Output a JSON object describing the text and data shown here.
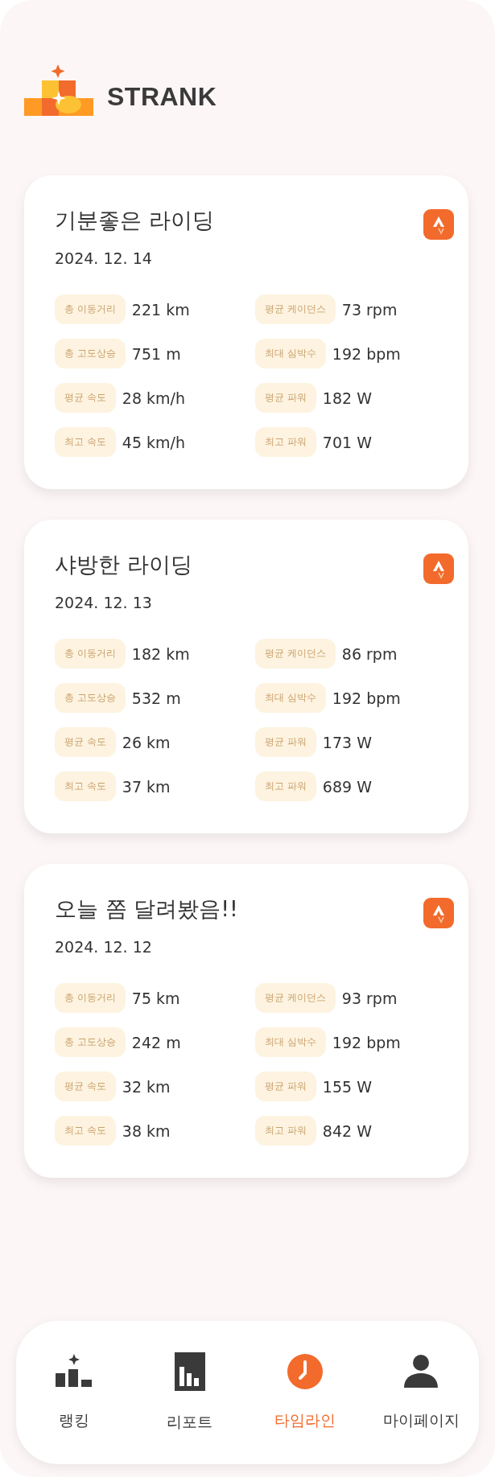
{
  "brand": {
    "name": "STRANK"
  },
  "rides": [
    {
      "title": "기분좋은 라이딩",
      "date": "2024. 12. 14",
      "stats": [
        {
          "label": "총 이동거리",
          "value": "221 km"
        },
        {
          "label": "평균 케이던스",
          "value": "73 rpm"
        },
        {
          "label": "총 고도상승",
          "value": "751 m"
        },
        {
          "label": "최대 심박수",
          "value": "192 bpm"
        },
        {
          "label": "평균 속도",
          "value": "28 km/h"
        },
        {
          "label": "평균 파워",
          "value": "182 W"
        },
        {
          "label": "최고 속도",
          "value": "45 km/h"
        },
        {
          "label": "최고 파워",
          "value": "701 W"
        }
      ]
    },
    {
      "title": "샤방한 라이딩",
      "date": "2024. 12. 13",
      "stats": [
        {
          "label": "총 이동거리",
          "value": "182 km"
        },
        {
          "label": "평균 케이던스",
          "value": "86 rpm"
        },
        {
          "label": "총 고도상승",
          "value": "532 m"
        },
        {
          "label": "최대 심박수",
          "value": "192 bpm"
        },
        {
          "label": "평균 속도",
          "value": "26 km"
        },
        {
          "label": "평균 파워",
          "value": "173 W"
        },
        {
          "label": "최고 속도",
          "value": "37 km"
        },
        {
          "label": "최고 파워",
          "value": "689 W"
        }
      ]
    },
    {
      "title": "오늘 쫌 달려봤음!!",
      "date": "2024. 12. 12",
      "stats": [
        {
          "label": "총 이동거리",
          "value": "75 km"
        },
        {
          "label": "평균 케이던스",
          "value": "93 rpm"
        },
        {
          "label": "총 고도상승",
          "value": "242 m"
        },
        {
          "label": "최대 심박수",
          "value": "192 bpm"
        },
        {
          "label": "평균 속도",
          "value": "32 km"
        },
        {
          "label": "평균 파워",
          "value": "155 W"
        },
        {
          "label": "최고 속도",
          "value": "38 km"
        },
        {
          "label": "최고 파워",
          "value": "842 W"
        }
      ]
    }
  ],
  "nav": [
    {
      "kind": "ranking",
      "label": "랭킹",
      "selected": false
    },
    {
      "kind": "report",
      "label": "리포트",
      "selected": false
    },
    {
      "kind": "timeline",
      "label": "타임라인",
      "selected": true
    },
    {
      "kind": "mypage",
      "label": "마이페이지",
      "selected": false
    }
  ]
}
